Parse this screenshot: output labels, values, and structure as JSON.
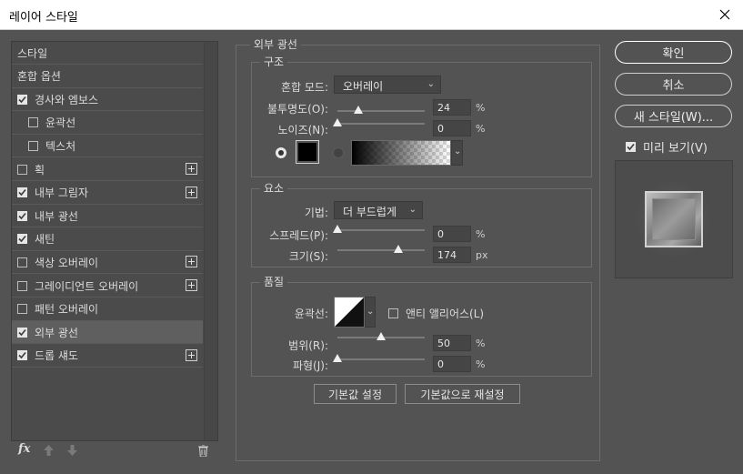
{
  "window": {
    "title": "레이어 스타일"
  },
  "styles_list": {
    "items": [
      {
        "label": "스타일",
        "checkbox": false,
        "checked": false,
        "indent": false,
        "plus": false,
        "selected": false
      },
      {
        "label": "혼합 옵션",
        "checkbox": false,
        "checked": false,
        "indent": false,
        "plus": false,
        "selected": false
      },
      {
        "label": "경사와 엠보스",
        "checkbox": true,
        "checked": true,
        "indent": false,
        "plus": false,
        "selected": false
      },
      {
        "label": "윤곽선",
        "checkbox": true,
        "checked": false,
        "indent": true,
        "plus": false,
        "selected": false
      },
      {
        "label": "텍스처",
        "checkbox": true,
        "checked": false,
        "indent": true,
        "plus": false,
        "selected": false
      },
      {
        "label": "획",
        "checkbox": true,
        "checked": false,
        "indent": false,
        "plus": true,
        "selected": false
      },
      {
        "label": "내부 그림자",
        "checkbox": true,
        "checked": true,
        "indent": false,
        "plus": true,
        "selected": false
      },
      {
        "label": "내부 광선",
        "checkbox": true,
        "checked": true,
        "indent": false,
        "plus": false,
        "selected": false
      },
      {
        "label": "새틴",
        "checkbox": true,
        "checked": true,
        "indent": false,
        "plus": false,
        "selected": false
      },
      {
        "label": "색상 오버레이",
        "checkbox": true,
        "checked": false,
        "indent": false,
        "plus": true,
        "selected": false
      },
      {
        "label": "그레이디언트 오버레이",
        "checkbox": true,
        "checked": false,
        "indent": false,
        "plus": true,
        "selected": false
      },
      {
        "label": "패턴 오버레이",
        "checkbox": true,
        "checked": false,
        "indent": false,
        "plus": false,
        "selected": false
      },
      {
        "label": "외부 광선",
        "checkbox": true,
        "checked": true,
        "indent": false,
        "plus": false,
        "selected": true
      },
      {
        "label": "드롭 섀도",
        "checkbox": true,
        "checked": true,
        "indent": false,
        "plus": true,
        "selected": false
      }
    ],
    "footer_icons": [
      "fx-icon",
      "move-up-icon",
      "move-down-icon",
      "trash-icon"
    ],
    "fx_label": "fx"
  },
  "panel": {
    "title": "외부 광선",
    "structure": {
      "title": "구조",
      "blend_mode_label": "혼합 모드:",
      "blend_mode_value": "오버레이",
      "opacity_label": "불투명도(O):",
      "opacity_value": "24",
      "opacity_unit": "%",
      "opacity_pct": 24,
      "noise_label": "노이즈(N):",
      "noise_value": "0",
      "noise_unit": "%",
      "noise_pct": 0,
      "color": "#000000"
    },
    "elements": {
      "title": "요소",
      "technique_label": "기법:",
      "technique_value": "더 부드럽게",
      "spread_label": "스프레드(P):",
      "spread_value": "0",
      "spread_unit": "%",
      "spread_pct": 0,
      "size_label": "크기(S):",
      "size_value": "174",
      "size_unit": "px",
      "size_max": 250
    },
    "quality": {
      "title": "품질",
      "contour_label": "윤곽선:",
      "antialias_label": "앤티 앨리어스(L)",
      "antialias_checked": false,
      "range_label": "범위(R):",
      "range_value": "50",
      "range_unit": "%",
      "range_pct": 50,
      "jitter_label": "파형(J):",
      "jitter_value": "0",
      "jitter_unit": "%",
      "jitter_pct": 0
    },
    "make_default_label": "기본값 설정",
    "reset_default_label": "기본값으로 재설정"
  },
  "right": {
    "ok_label": "확인",
    "cancel_label": "취소",
    "new_style_label": "새 스타일(W)...",
    "preview_label": "미리 보기(V)",
    "preview_checked": true
  },
  "colors": {
    "background": "#535353",
    "selected_row": "#5f5f5f",
    "accent": "#ffffff"
  }
}
